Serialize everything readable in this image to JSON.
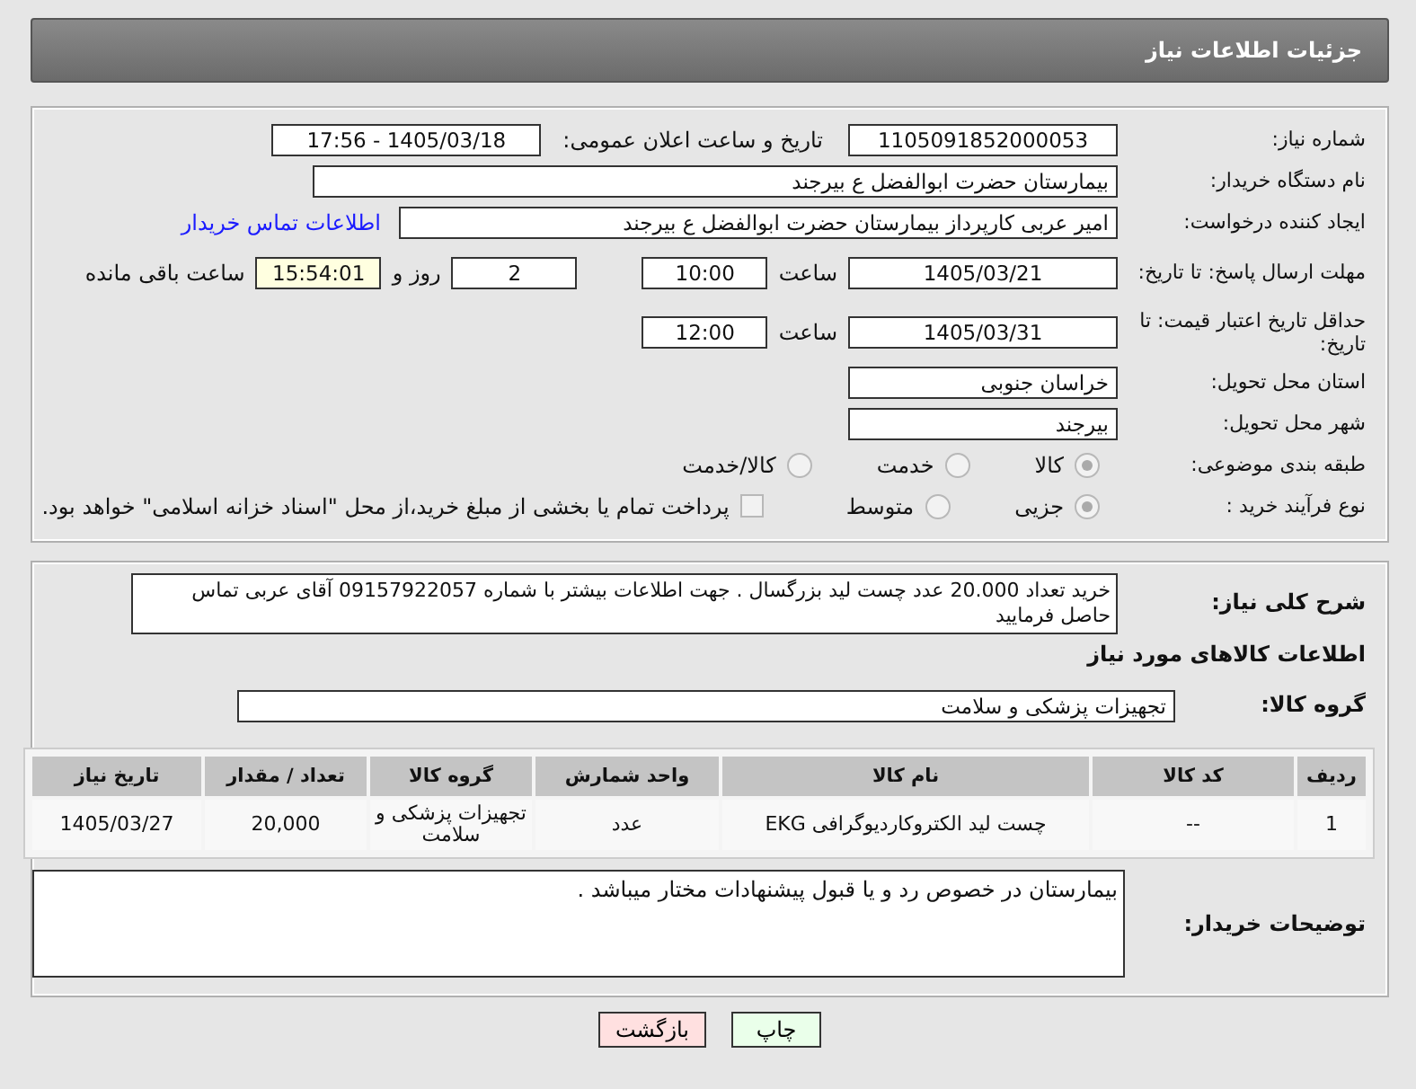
{
  "title": "جزئیات اطلاعات نیاز",
  "need_number": {
    "label": "شماره نیاز:",
    "value": "1105091852000053"
  },
  "announce": {
    "label": "تاریخ و ساعت اعلان عمومی:",
    "value": "1405/03/18 - 17:56"
  },
  "buyer_org": {
    "label": "نام دستگاه خریدار:",
    "value": "بیمارستان حضرت ابوالفضل  ع  بیرجند"
  },
  "requester": {
    "label": "ایجاد کننده درخواست:",
    "value": "امیر عربی کارپرداز بیمارستان حضرت ابوالفضل  ع  بیرجند",
    "link": "اطلاعات تماس خریدار"
  },
  "deadline": {
    "label": "مهلت ارسال پاسخ: تا تاریخ:",
    "date": "1405/03/21",
    "time_label": "ساعت",
    "time": "10:00",
    "days": "2",
    "days_label": "روز و",
    "remaining": "15:54:01",
    "remaining_label": "ساعت باقی مانده"
  },
  "validity": {
    "label": "حداقل تاریخ اعتبار قیمت: تا تاریخ:",
    "date": "1405/03/31",
    "time_label": "ساعت",
    "time": "12:00"
  },
  "province": {
    "label": "استان محل تحویل:",
    "value": "خراسان جنوبی"
  },
  "city": {
    "label": "شهر محل تحویل:",
    "value": "بیرجند"
  },
  "category": {
    "label": "طبقه بندی موضوعی:",
    "options": [
      {
        "label": "کالا",
        "selected": true
      },
      {
        "label": "خدمت",
        "selected": false
      },
      {
        "label": "کالا/خدمت",
        "selected": false
      }
    ]
  },
  "process": {
    "label": "نوع فرآیند خرید :",
    "options": [
      {
        "label": "جزیی",
        "selected": true
      },
      {
        "label": "متوسط",
        "selected": false
      }
    ],
    "payment": {
      "label": "پرداخت تمام یا بخشی از مبلغ خرید،از محل \"اسناد خزانه اسلامی\" خواهد بود.",
      "checked": false
    }
  },
  "description": {
    "label": "شرح کلی نیاز:",
    "value": "خرید تعداد 20.000 عدد  چست لید بزرگسال . جهت اطلاعات بیشتر با شماره 09157922057 آقای عربی تماس حاصل فرمایید"
  },
  "goods_heading": "اطلاعات کالاهای مورد نیاز",
  "goods_group": {
    "label": "گروه کالا:",
    "value": "تجهیزات پزشکی و سلامت"
  },
  "table": {
    "columns": [
      "ردیف",
      "کد کالا",
      "نام کالا",
      "واحد شمارش",
      "گروه کالا",
      "تعداد / مقدار",
      "تاریخ نیاز"
    ],
    "rows": [
      [
        "1",
        "--",
        "چست لید الکتروکاردیوگرافی EKG",
        "عدد",
        "تجهیزات پزشکی و سلامت",
        "20,000",
        "1405/03/27"
      ]
    ]
  },
  "buyer_notes": {
    "label": "توضیحات خریدار:",
    "value": "بیمارستان در خصوص رد و یا قبول پیشنهادات مختار میباشد ."
  },
  "buttons": [
    {
      "label": "چاپ",
      "kind": "print"
    },
    {
      "label": "بازگشت",
      "kind": "back"
    }
  ]
}
